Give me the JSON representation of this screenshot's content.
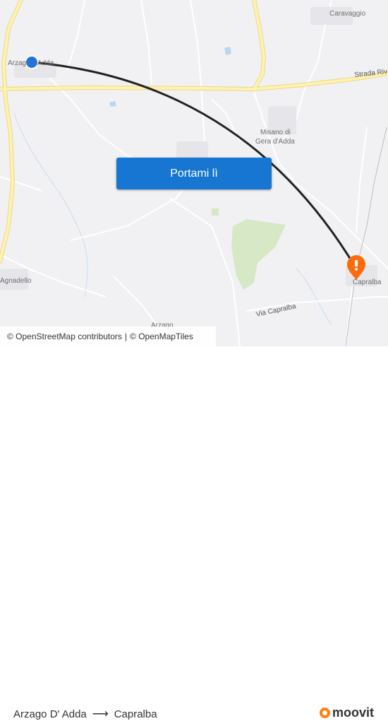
{
  "map": {
    "places": [
      {
        "id": "caravaggio",
        "label": "Caravaggio"
      },
      {
        "id": "arzago",
        "label": "Arzago d'Adda"
      },
      {
        "id": "misano_1",
        "label": "Misano di"
      },
      {
        "id": "misano_2",
        "label": "Gera d'Adda"
      },
      {
        "id": "agnadello",
        "label": "Agnadello"
      },
      {
        "id": "capralba",
        "label": "Capralba"
      },
      {
        "id": "arzago_bottom",
        "label": "Arzago"
      }
    ],
    "roads": [
      {
        "id": "strada",
        "label": "Strada Riv"
      },
      {
        "id": "via_capralba",
        "label": "Via Capralba"
      }
    ],
    "origin_marker": {
      "color": "#1a73e8"
    },
    "destination_marker": {
      "color": "#ff6b0a",
      "icon": "map-pin-icon"
    },
    "route_line_color": "#222222"
  },
  "cta": {
    "label": "Portami lì"
  },
  "attribution": {
    "osm_contrib": "© OpenStreetMap contributors",
    "separator": "|",
    "openmaptiles": "© OpenMapTiles"
  },
  "footer": {
    "origin": "Arzago D' Adda",
    "arrow_icon": "arrow-right-icon",
    "destination": "Capralba",
    "brand": "moovit",
    "brand_color": "#ff7d0f"
  }
}
